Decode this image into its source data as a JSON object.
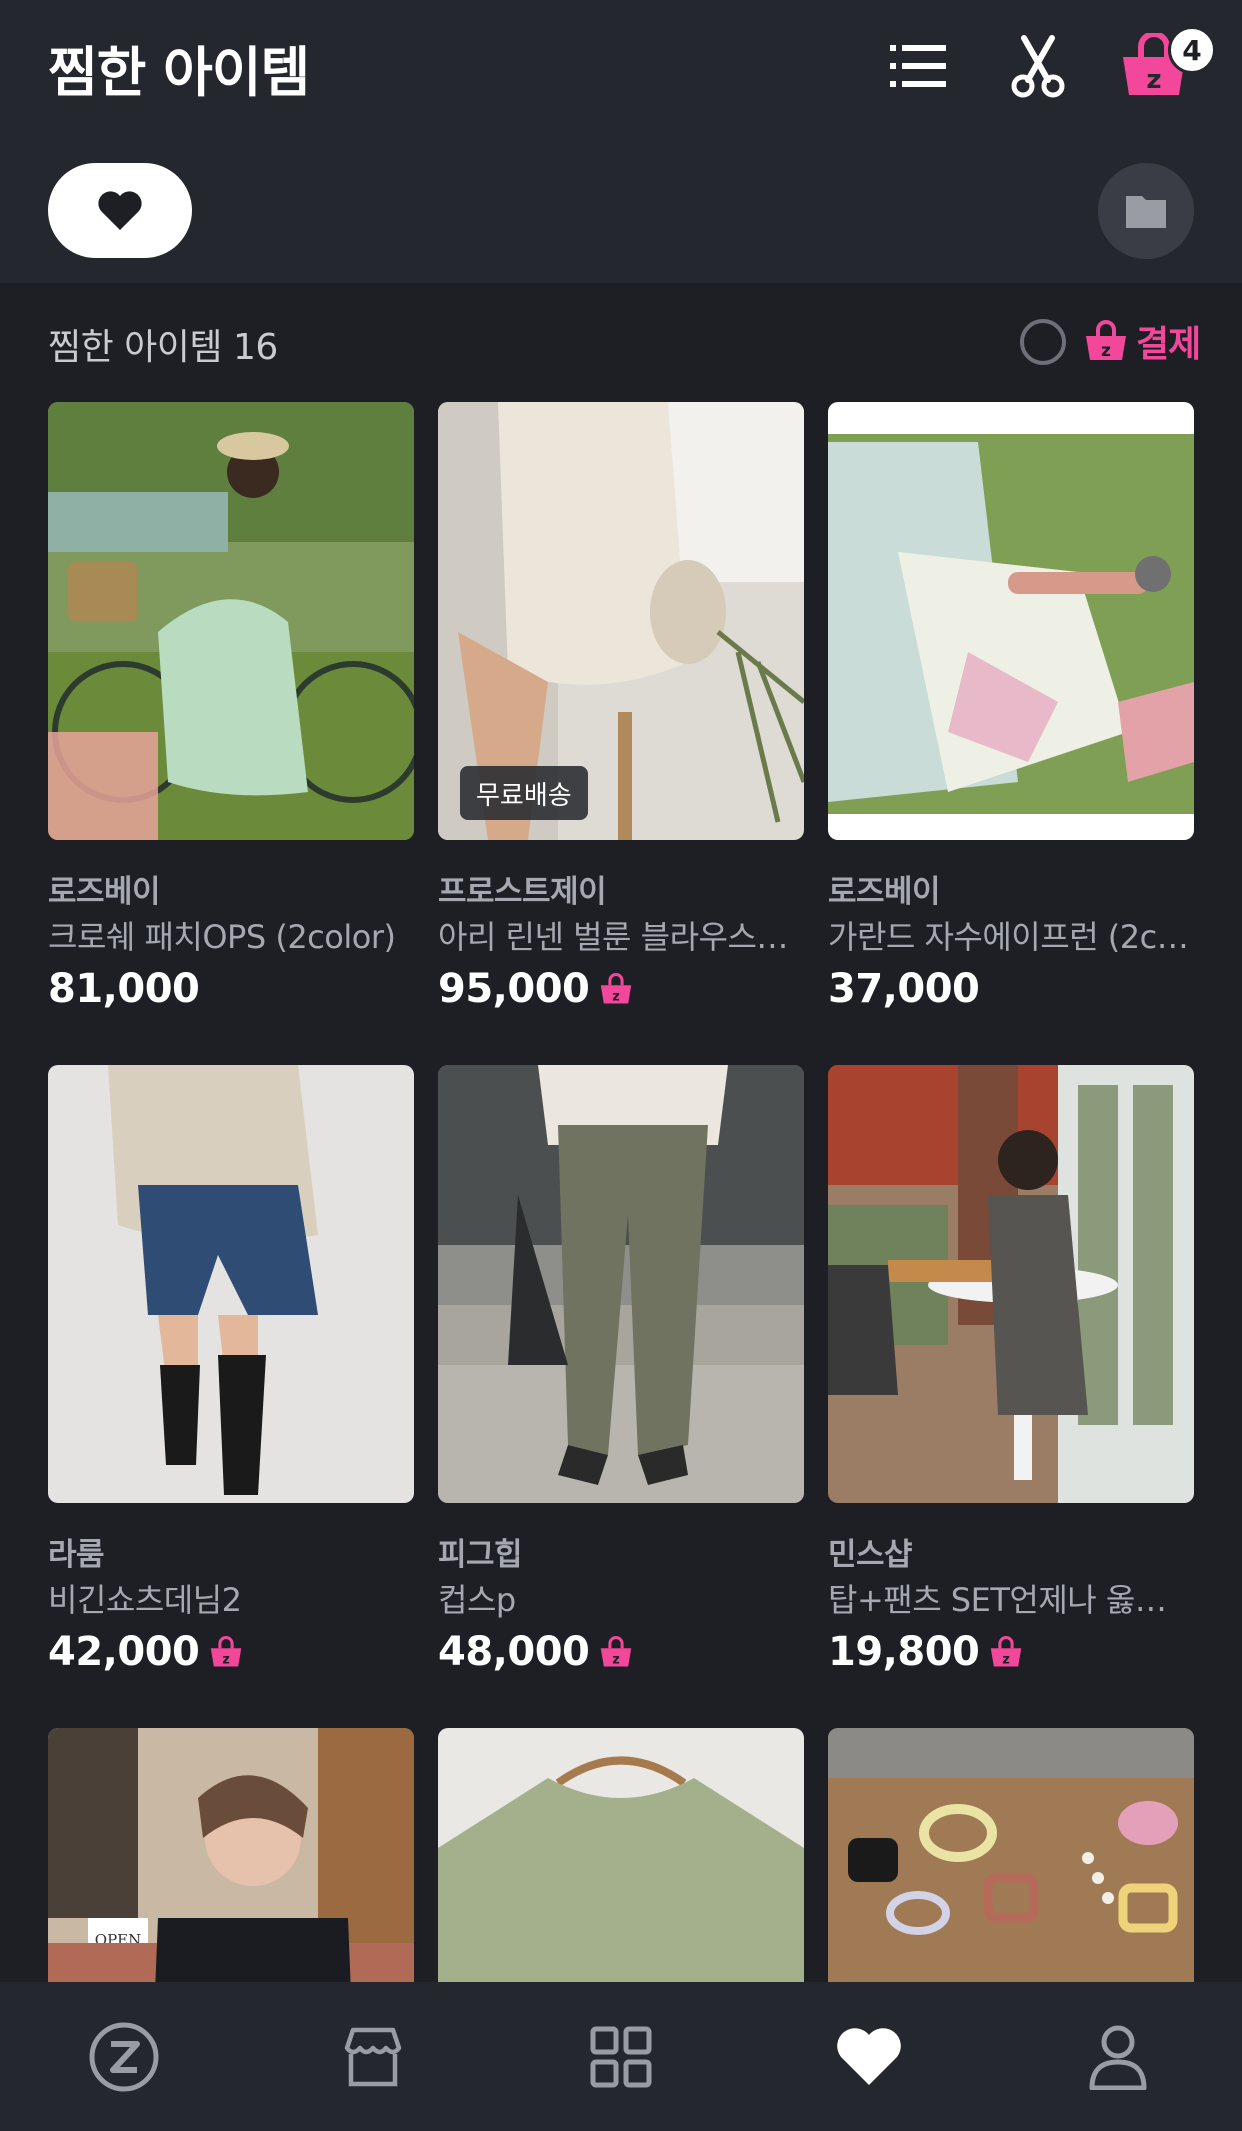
{
  "header": {
    "title": "찜한 아이템",
    "list_icon": "list-icon",
    "scissors_icon": "scissors-icon",
    "cart_icon": "zigzag-cart-icon",
    "cart_count": "4"
  },
  "filter": {
    "heart_icon": "heart-icon",
    "folder_icon": "folder-icon"
  },
  "summary": {
    "count_label": "찜한 아이템 16",
    "checkout_label": "결제"
  },
  "colors": {
    "accent_pink": "#f2479b",
    "background": "#1d1f25",
    "header_bg": "#24272e"
  },
  "products": [
    {
      "store": "로즈베이",
      "name": "크로쉐 패치OPS (2color)",
      "price": "81,000",
      "zpay": false,
      "tag": ""
    },
    {
      "store": "프로스트제이",
      "name": "아리 린넨 벌룬 블라우스…",
      "price": "95,000",
      "zpay": true,
      "tag": "무료배송"
    },
    {
      "store": "로즈베이",
      "name": "가란드 자수에이프런 (2c…",
      "price": "37,000",
      "zpay": false,
      "tag": ""
    },
    {
      "store": "라룸",
      "name": "비긴쇼츠데님2",
      "price": "42,000",
      "zpay": true,
      "tag": ""
    },
    {
      "store": "피그힙",
      "name": "컵스p",
      "price": "48,000",
      "zpay": true,
      "tag": ""
    },
    {
      "store": "민스샵",
      "name": "탑+팬츠 SET언제나 옳은…",
      "price": "19,800",
      "zpay": true,
      "tag": ""
    }
  ],
  "partial_row": {
    "image_sign_text": "OPEN"
  },
  "nav": {
    "items": [
      "zigzag-home-icon",
      "store-icon",
      "category-icon",
      "heart-icon",
      "profile-icon"
    ],
    "active": "heart-icon"
  }
}
